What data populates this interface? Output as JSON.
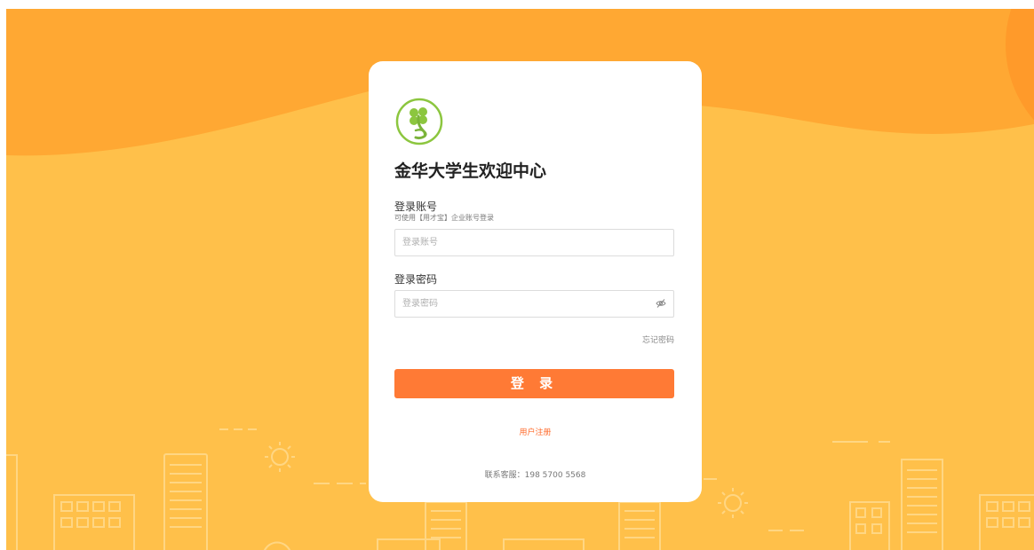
{
  "app": {
    "title": "金华大学生欢迎中心",
    "logo_icon": "clover-logo-icon"
  },
  "account": {
    "label": "登录账号",
    "hint": "可使用【用才宝】企业账号登录",
    "placeholder": "登录账号"
  },
  "password": {
    "label": "登录密码",
    "placeholder": "登录密码",
    "toggle_icon": "eye-off-icon"
  },
  "links": {
    "forgot": "忘记密码",
    "register": "用户注册"
  },
  "login_button": "登 录",
  "service": "联系客服：198 5700 5568",
  "colors": {
    "background": "#ffc04a",
    "background_dark": "#ffa833",
    "primary": "#ff7a35",
    "link": "#ff6a2a",
    "logo": "#8cc63f"
  }
}
